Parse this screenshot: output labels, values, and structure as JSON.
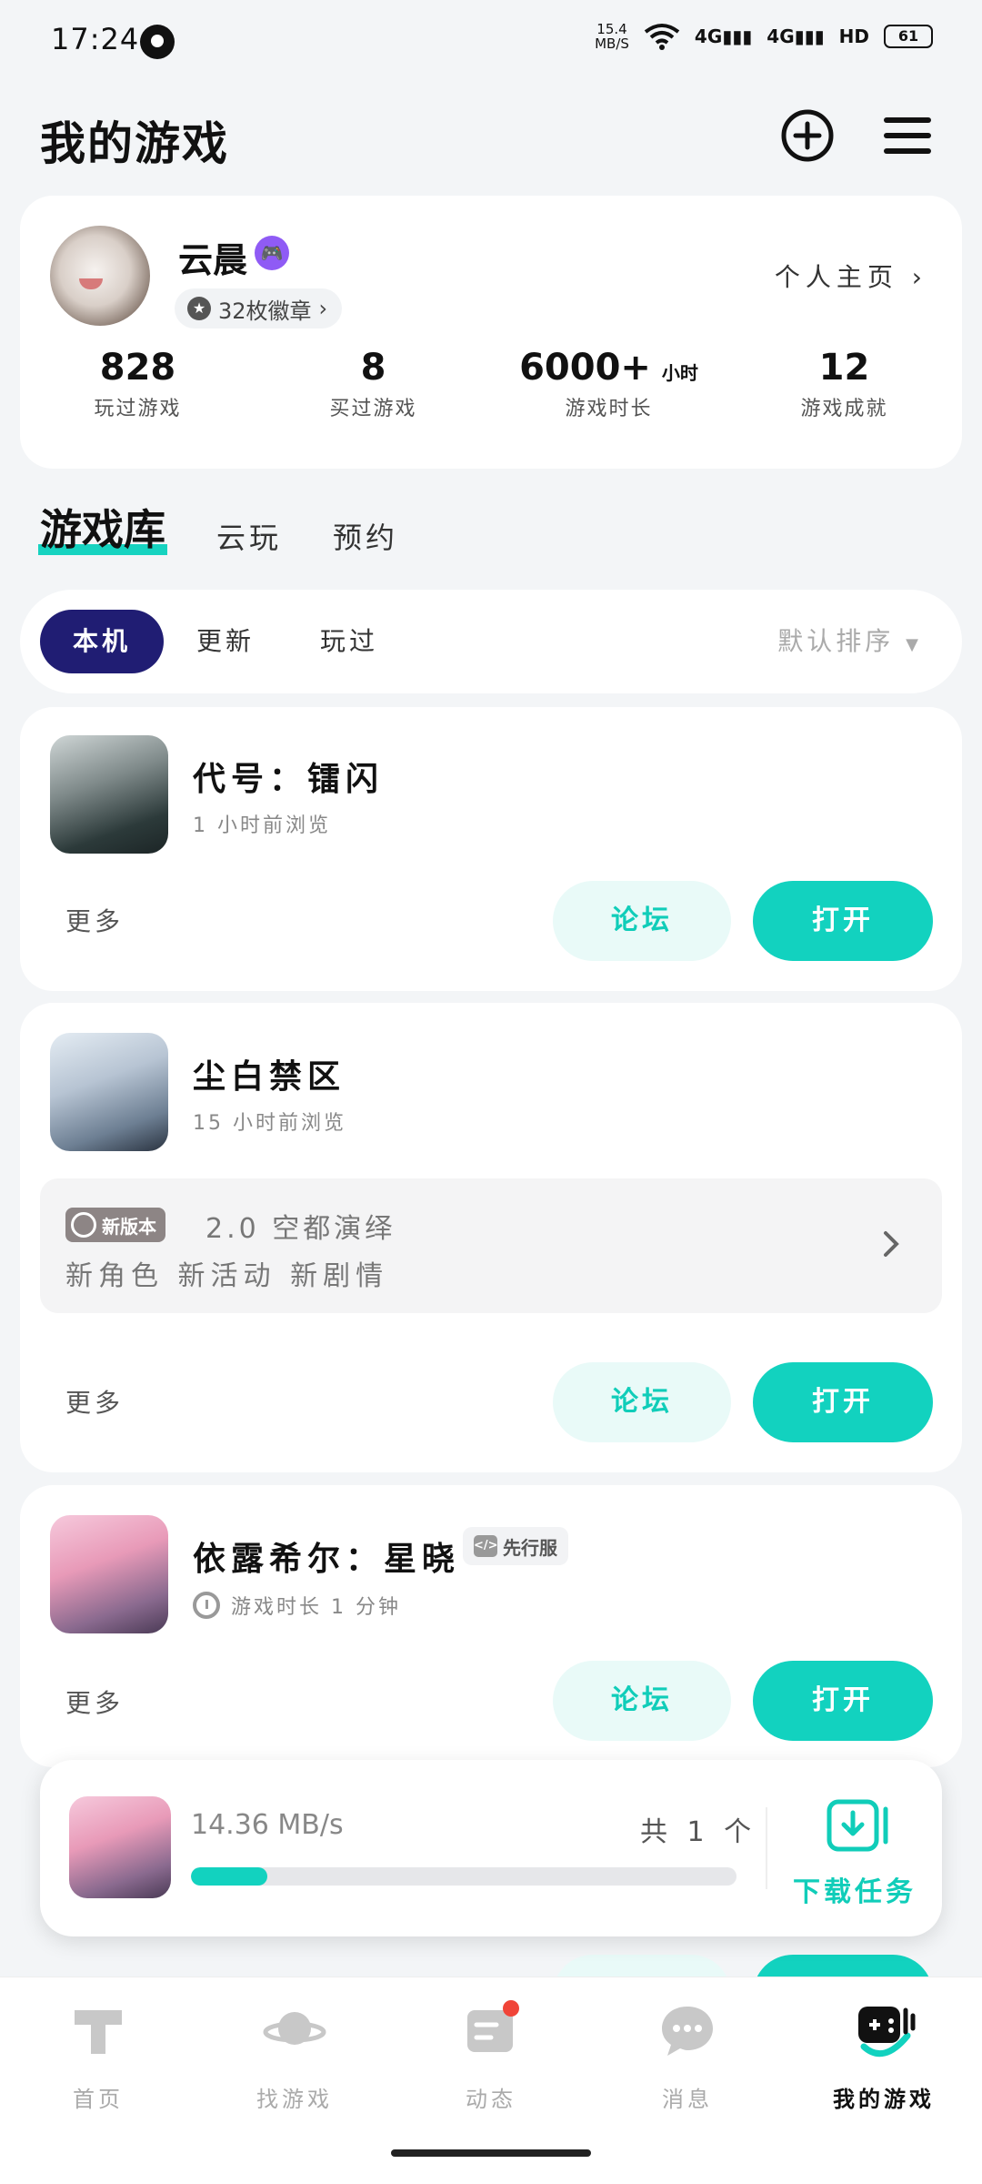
{
  "status": {
    "time": "17:24",
    "net_speed_value": "15.4",
    "net_speed_unit": "MB/S",
    "signal1": "4G",
    "signal2": "4G",
    "hd": "HD",
    "battery": "61"
  },
  "header": {
    "title": "我的游戏",
    "add_icon": "plus-circle-icon",
    "menu_icon": "hamburger-menu-icon"
  },
  "profile": {
    "name": "云晨",
    "badges_label": "32枚徽章",
    "homepage_label": "个人主页",
    "stats": [
      {
        "value": "828",
        "unit": "",
        "label": "玩过游戏"
      },
      {
        "value": "8",
        "unit": "",
        "label": "买过游戏"
      },
      {
        "value": "6000+",
        "unit": "小时",
        "label": "游戏时长"
      },
      {
        "value": "12",
        "unit": "",
        "label": "游戏成就"
      }
    ]
  },
  "tabs": {
    "library": "游戏库",
    "cloud": "云玩",
    "reserve": "预约"
  },
  "filters": {
    "local": "本机",
    "update": "更新",
    "played": "玩过",
    "sort": "默认排序"
  },
  "games": [
    {
      "name": "代号：镭闪",
      "sub": "1 小时前浏览",
      "more": "更多",
      "forum": "论坛",
      "open": "打开"
    },
    {
      "name": "尘白禁区",
      "sub": "15 小时前浏览",
      "more": "更多",
      "forum": "论坛",
      "open": "打开",
      "update_tag": "新版本",
      "update_title": "2.0 空都演绎",
      "update_desc": "新角色 新活动 新剧情"
    },
    {
      "name": "依露希尔：星晓",
      "tag": "先行服",
      "sub": "游戏时长 1 分钟",
      "more": "更多",
      "forum": "论坛",
      "open": "打开"
    }
  ],
  "download": {
    "speed": "14.36 MB/s",
    "count": "共 1 个",
    "progress": 0.14,
    "task_label": "下载任务"
  },
  "nav": [
    {
      "label": "首页",
      "icon": "home-icon"
    },
    {
      "label": "找游戏",
      "icon": "planet-icon"
    },
    {
      "label": "动态",
      "icon": "feed-icon"
    },
    {
      "label": "消息",
      "icon": "chat-icon"
    },
    {
      "label": "我的游戏",
      "icon": "gamepad-icon"
    }
  ],
  "colors": {
    "accent": "#12d2bf",
    "active_filter": "#201d73",
    "vip": "#8f5bf5",
    "notify_dot": "#f04438"
  }
}
